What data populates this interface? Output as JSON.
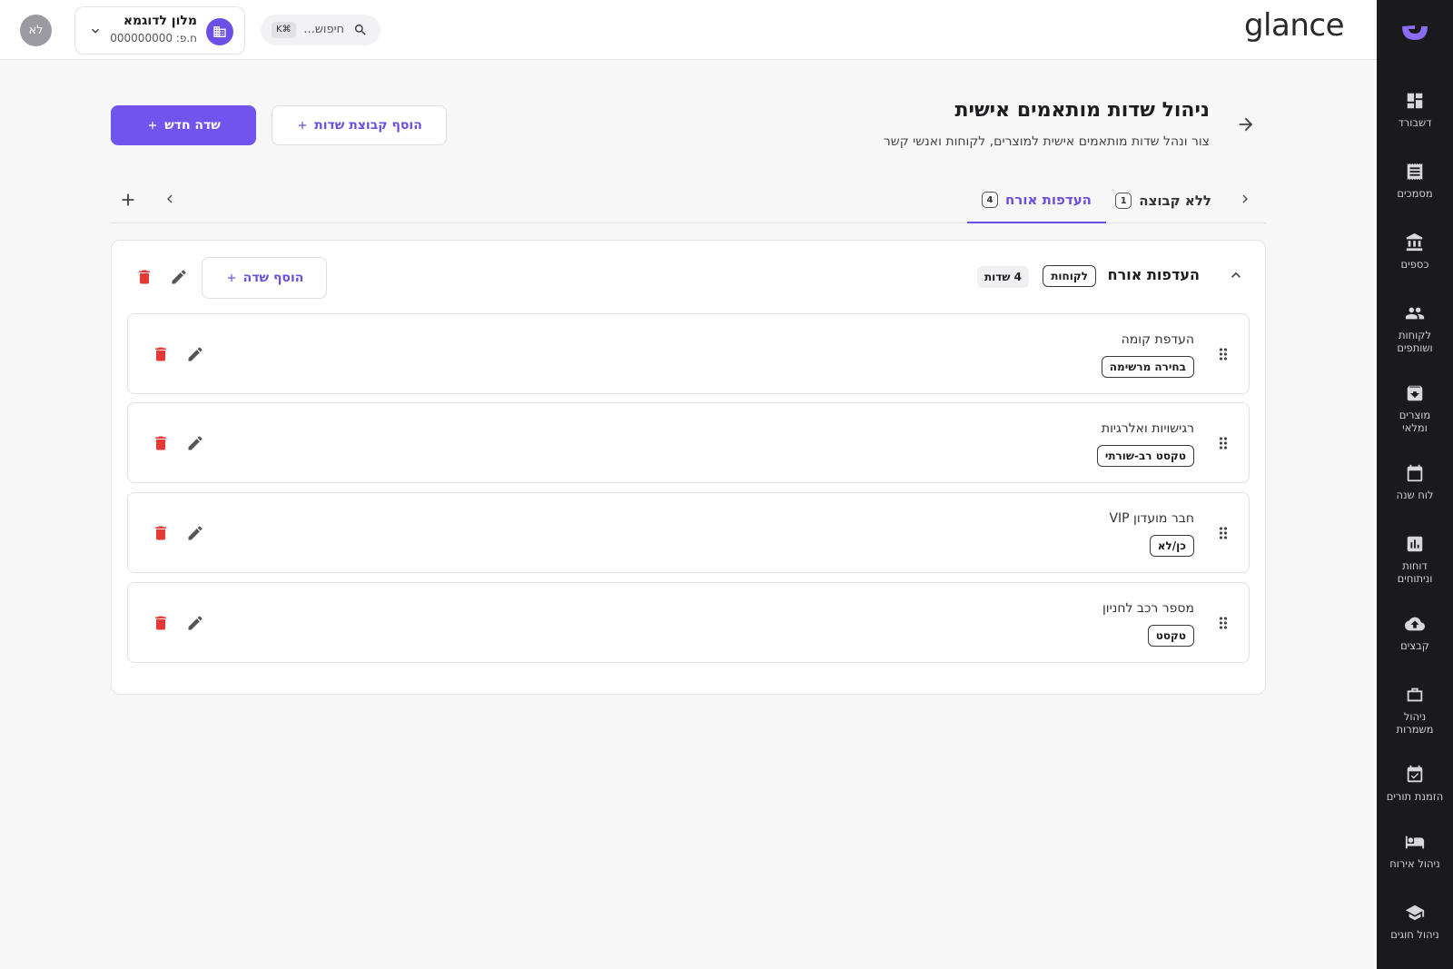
{
  "brand": "glance",
  "user": {
    "initials": "לא"
  },
  "hotel": {
    "name": "מלון לדוגמא",
    "id_label": "ח.פ: 000000000"
  },
  "search": {
    "placeholder": "חיפוש...",
    "shortcut": "⌘K"
  },
  "sidebar": {
    "items": [
      {
        "label": "דשבורד",
        "icon": "dashboard-icon"
      },
      {
        "label": "מסמכים",
        "icon": "receipt-icon"
      },
      {
        "label": "כספים",
        "icon": "bank-icon"
      },
      {
        "label": "לקוחות ושותפים",
        "icon": "people-icon"
      },
      {
        "label": "מוצרים ומלאי",
        "icon": "archive-icon"
      },
      {
        "label": "לוח שנה",
        "icon": "calendar-icon"
      },
      {
        "label": "דוחות וניתוחים",
        "icon": "chart-icon"
      },
      {
        "label": "קבצים",
        "icon": "cloud-upload-icon"
      },
      {
        "label": "ניהול משמרות",
        "icon": "briefcase-icon"
      },
      {
        "label": "הזמנת תורים",
        "icon": "calendar-check-icon"
      },
      {
        "label": "ניהול אירוח",
        "icon": "bed-icon"
      },
      {
        "label": "ניהול חוגים",
        "icon": "school-icon"
      }
    ]
  },
  "page": {
    "title": "ניהול שדות מותאמים אישית",
    "subtitle": "צור ונהל שדות מותאמים אישית למוצרים, לקוחות ואנשי קשר",
    "new_field_button": "שדה חדש",
    "add_group_button": "הוסף קבוצת שדות"
  },
  "tabs": [
    {
      "label": "ללא קבוצה",
      "count": "1"
    },
    {
      "label": "העדפות אורח",
      "count": "4",
      "active": true
    }
  ],
  "group": {
    "title": "העדפות אורח",
    "tag": "לקוחות",
    "fields_count": "4 שדות",
    "add_field_button": "הוסף שדה",
    "fields": [
      {
        "name": "העדפת קומה",
        "type": "בחירה מרשימה"
      },
      {
        "name": "רגישויות ואלרגיות",
        "type": "טקסט רב-שורתי"
      },
      {
        "name": "חבר מועדון VIP",
        "type": "כן/לא"
      },
      {
        "name": "מספר רכב לחניון",
        "type": "טקסט"
      }
    ]
  },
  "colors": {
    "accent": "#7054ec",
    "delete": "#e53935",
    "sidebar_bg": "#1a1a1d"
  }
}
